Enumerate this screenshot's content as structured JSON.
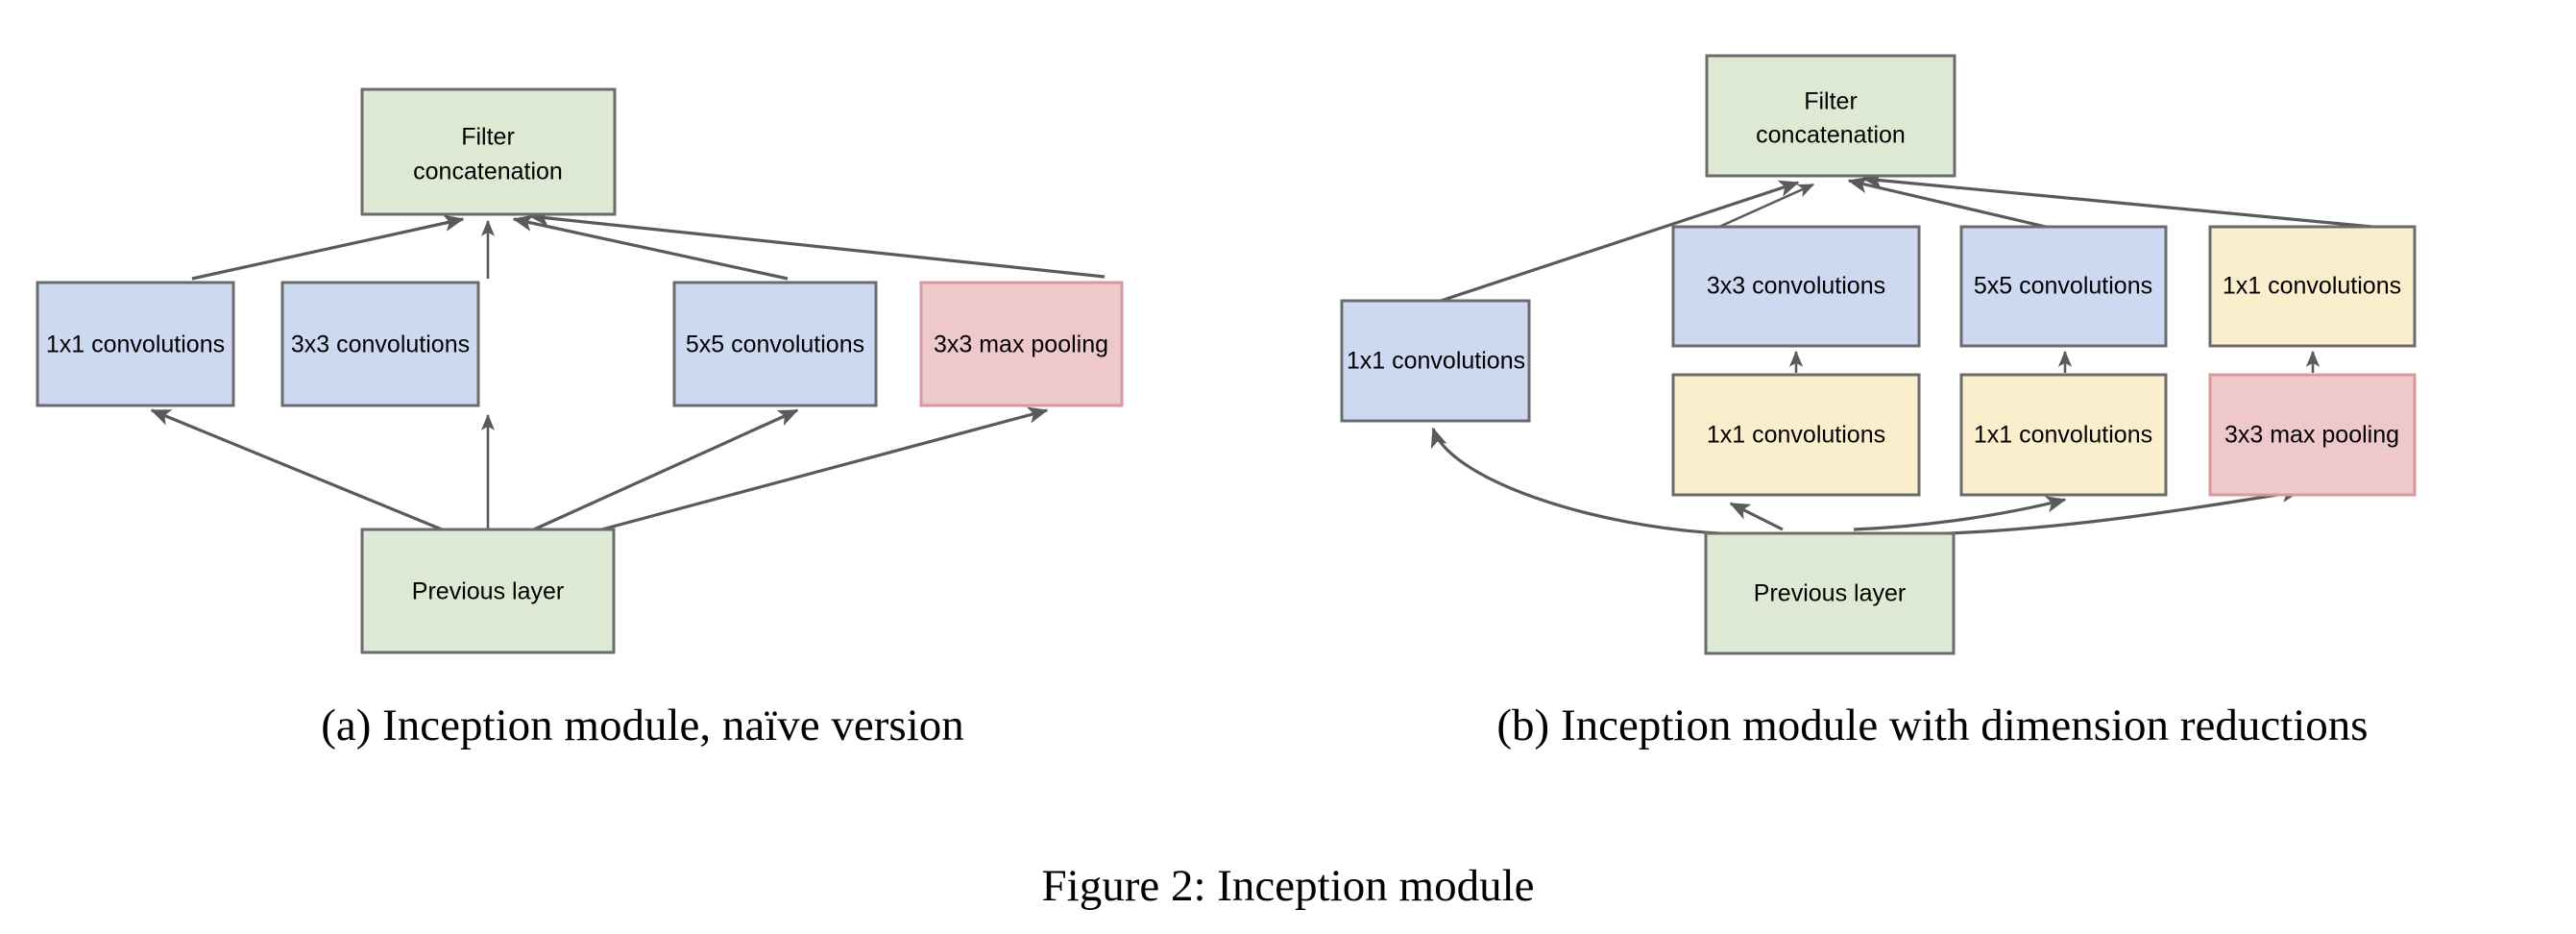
{
  "figure": {
    "caption": "Figure 2: Inception module",
    "panels": [
      {
        "id": "a",
        "caption": "(a)  Inception module, naïve version",
        "nodes": [
          {
            "key": "a_concat",
            "label": "Filter\nconcatenation",
            "line1": "Filter",
            "line2": "concatenation",
            "color": "green"
          },
          {
            "key": "a_conv1",
            "label": "1x1 convolutions",
            "color": "blue"
          },
          {
            "key": "a_conv3",
            "label": "3x3 convolutions",
            "color": "blue"
          },
          {
            "key": "a_conv5",
            "label": "5x5 convolutions",
            "color": "blue"
          },
          {
            "key": "a_pool3",
            "label": "3x3 max pooling",
            "color": "red"
          },
          {
            "key": "a_prev",
            "label": "Previous layer",
            "color": "green"
          }
        ]
      },
      {
        "id": "b",
        "caption": "(b)  Inception module with dimension reductions",
        "nodes": [
          {
            "key": "b_concat",
            "label": "Filter\nconcatenation",
            "line1": "Filter",
            "line2": "concatenation",
            "color": "green"
          },
          {
            "key": "b_conv1L",
            "label": "1x1 convolutions",
            "color": "blue"
          },
          {
            "key": "b_conv3",
            "label": "3x3 convolutions",
            "color": "blue"
          },
          {
            "key": "b_conv5",
            "label": "5x5 convolutions",
            "color": "blue"
          },
          {
            "key": "b_conv1R",
            "label": "1x1 convolutions",
            "color": "yellow"
          },
          {
            "key": "b_red3",
            "label": "1x1 convolutions",
            "color": "yellow"
          },
          {
            "key": "b_red5",
            "label": "1x1 convolutions",
            "color": "yellow"
          },
          {
            "key": "b_pool3",
            "label": "3x3 max pooling",
            "color": "red"
          },
          {
            "key": "b_prev",
            "label": "Previous layer",
            "color": "green"
          }
        ]
      }
    ]
  },
  "colors": {
    "green_fill": "#dde9d3",
    "green_stroke": "#6b6b6b",
    "blue_fill": "#ccd9f0",
    "blue_stroke": "#6b6b6b",
    "yellow_fill": "#fbeecd",
    "yellow_stroke": "#6b6b6b",
    "red_fill": "#eec8cb",
    "red_stroke": "#d79a9e",
    "edge": "#5a5a5a",
    "text": "#000000",
    "background": "#ffffff"
  },
  "labels": {
    "filter_line1": "Filter",
    "filter_line2": "concatenation",
    "conv1x1": "1x1 convolutions",
    "conv3x3": "3x3 convolutions",
    "conv5x5": "5x5 convolutions",
    "pool3x3": "3x3 max pooling",
    "previous_layer": "Previous layer"
  },
  "chart_data": {
    "type": "diagram",
    "title": "Figure 2: Inception module",
    "panels": [
      {
        "label": "(a)  Inception module, naïve version",
        "nodes": [
          "Filter concatenation",
          "1x1 convolutions",
          "3x3 convolutions",
          "5x5 convolutions",
          "3x3 max pooling",
          "Previous layer"
        ],
        "edges": [
          [
            "Previous layer",
            "1x1 convolutions"
          ],
          [
            "Previous layer",
            "3x3 convolutions"
          ],
          [
            "Previous layer",
            "5x5 convolutions"
          ],
          [
            "Previous layer",
            "3x3 max pooling"
          ],
          [
            "1x1 convolutions",
            "Filter concatenation"
          ],
          [
            "3x3 convolutions",
            "Filter concatenation"
          ],
          [
            "5x5 convolutions",
            "Filter concatenation"
          ],
          [
            "3x3 max pooling",
            "Filter concatenation"
          ]
        ]
      },
      {
        "label": "(b)  Inception module with dimension reductions",
        "nodes": [
          "Filter concatenation",
          "1x1 convolutions (left)",
          "3x3 convolutions",
          "5x5 convolutions",
          "1x1 convolutions (right)",
          "1x1 convolutions (reduce 3x3)",
          "1x1 convolutions (reduce 5x5)",
          "3x3 max pooling",
          "Previous layer"
        ],
        "edges": [
          [
            "Previous layer",
            "1x1 convolutions (left)"
          ],
          [
            "Previous layer",
            "1x1 convolutions (reduce 3x3)"
          ],
          [
            "Previous layer",
            "1x1 convolutions (reduce 5x5)"
          ],
          [
            "Previous layer",
            "3x3 max pooling"
          ],
          [
            "1x1 convolutions (reduce 3x3)",
            "3x3 convolutions"
          ],
          [
            "1x1 convolutions (reduce 5x5)",
            "5x5 convolutions"
          ],
          [
            "3x3 max pooling",
            "1x1 convolutions (right)"
          ],
          [
            "1x1 convolutions (left)",
            "Filter concatenation"
          ],
          [
            "3x3 convolutions",
            "Filter concatenation"
          ],
          [
            "5x5 convolutions",
            "Filter concatenation"
          ],
          [
            "1x1 convolutions (right)",
            "Filter concatenation"
          ]
        ]
      }
    ]
  }
}
